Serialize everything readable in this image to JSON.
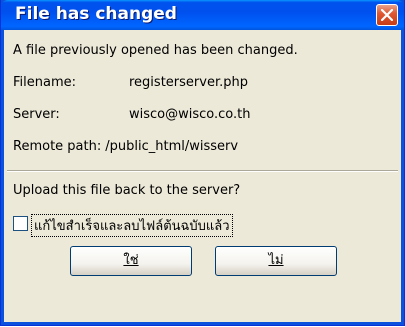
{
  "dialog": {
    "title": "File has changed",
    "close_icon": "close-icon",
    "message": "A file previously opened has been changed.",
    "details": {
      "filename_label": "Filename:",
      "filename_value": "registerserver.php",
      "server_label": "Server:",
      "server_value": "wisco@wisco.co.th",
      "remote_path_label": "Remote path:",
      "remote_path_value": "/public_html/wisserv"
    },
    "question": "Upload this file back to the server?",
    "checkbox_label": "แก้ไขสำเร็จและลบไฟล์ต้นฉบับแล้ว",
    "checkbox_checked": false,
    "buttons": {
      "yes_label": "ใช่",
      "no_label": "ไม่"
    },
    "colors": {
      "titlebar": "#0054e3",
      "client_bg": "#ece9d8",
      "close_button": "#d8491c"
    }
  }
}
